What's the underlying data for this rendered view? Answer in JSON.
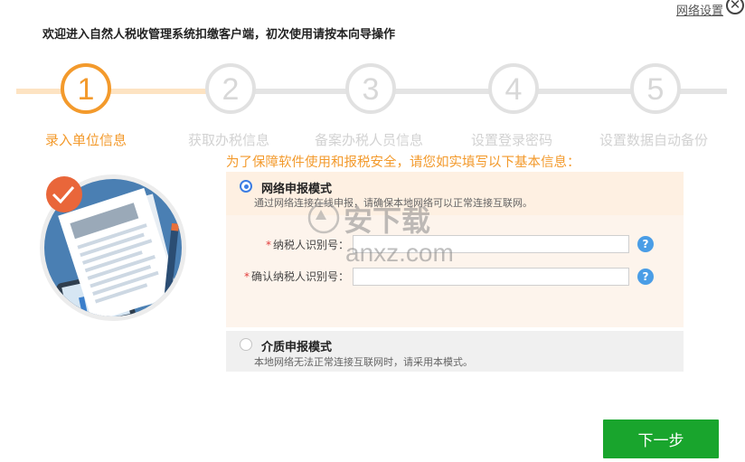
{
  "header": {
    "title": "欢迎进入自然人税收管理系统扣缴客户端，初次使用请按本向导操作",
    "network_settings": "网络设置",
    "close_symbol": "✕"
  },
  "steps": [
    {
      "number": "1",
      "label": "录入单位信息",
      "status": "active"
    },
    {
      "number": "2",
      "label": "获取办税信息",
      "status": "pending"
    },
    {
      "number": "3",
      "label": "备案办税人员信息",
      "status": "pending"
    },
    {
      "number": "4",
      "label": "设置登录密码",
      "status": "pending"
    },
    {
      "number": "5",
      "label": "设置数据自动备份",
      "status": "pending"
    }
  ],
  "colors": {
    "accent": "#f39a2c",
    "inactive": "#e1e1e1",
    "primary_button": "#19a52d",
    "radio": "#3c7de3",
    "help": "#4a9de6"
  },
  "form": {
    "intro": "为了保障软件使用和报税安全，请您如实填写以下基本信息：",
    "online_mode": {
      "title": "网络申报模式",
      "desc": "通过网络连接在线申报，请确保本地网络可以正常连接互联网。",
      "selected": true
    },
    "taxpayer_id": {
      "required_mark": "*",
      "label": "纳税人识别号：",
      "value": ""
    },
    "confirm_taxpayer_id": {
      "required_mark": "*",
      "label": "确认纳税人识别号：",
      "value": ""
    },
    "help_symbol": "?",
    "offline_mode": {
      "title": "介质申报模式",
      "desc": "本地网络无法正常连接互联网时，请采用本模式。",
      "selected": false
    }
  },
  "watermark": {
    "name": "安下载",
    "url": "anxz.com"
  },
  "footer": {
    "next_button": "下一步"
  }
}
